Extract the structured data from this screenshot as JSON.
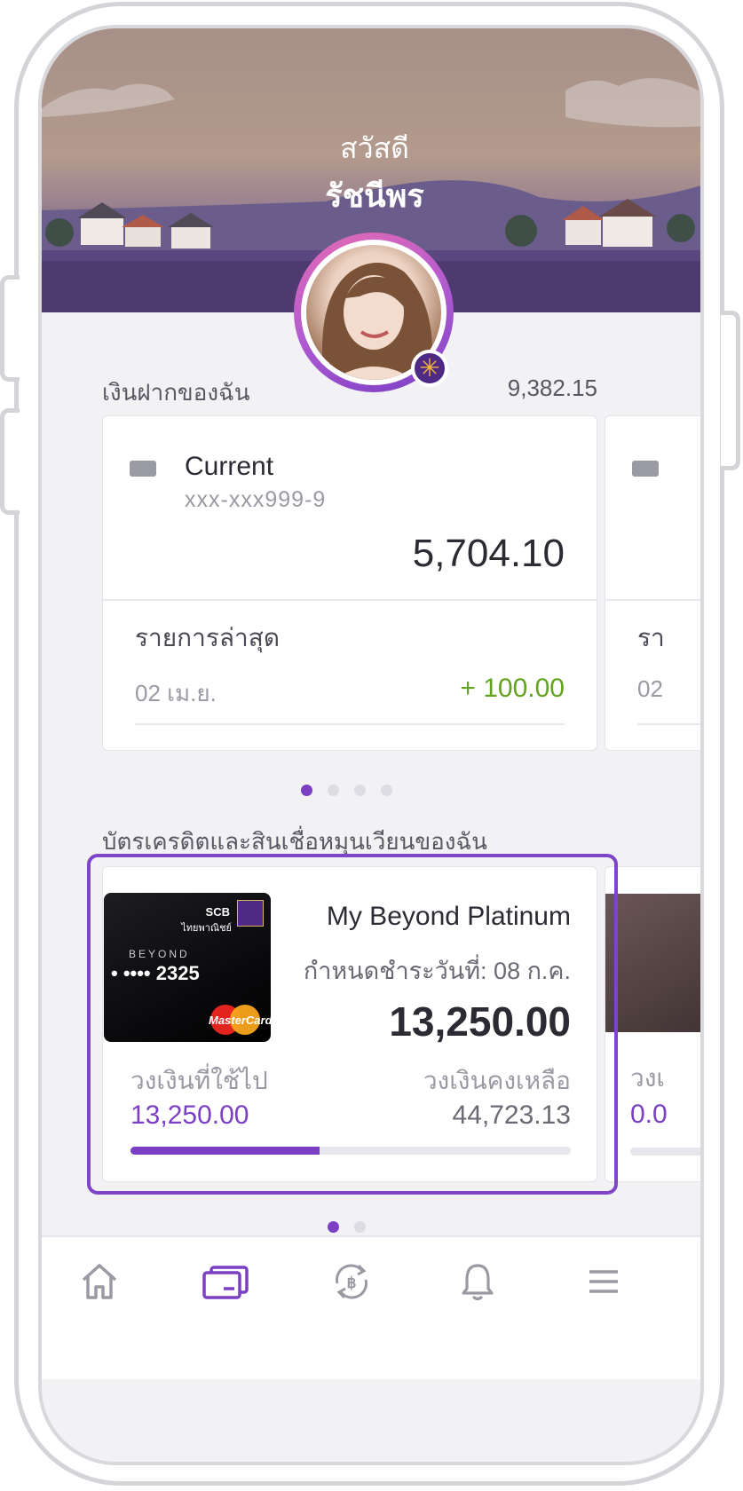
{
  "header": {
    "greeting": "สวัสดี",
    "name": "รัชนีพร"
  },
  "deposits": {
    "title": "เงินฝากของฉัน",
    "total": "9,382.15",
    "account": {
      "name": "Current",
      "number": "xxx-xxx999-9",
      "balance": "5,704.10",
      "recent_title": "รายการล่าสุด",
      "recent_date": "02 เม.ย.",
      "recent_amount": "+ 100.00"
    },
    "peek_card": {
      "recent_title_partial": "รา",
      "recent_date_partial": "02"
    },
    "pager": {
      "count": 4,
      "active": 0
    }
  },
  "credit": {
    "title": "บัตรเครดิตและสินเชื่อหมุนเวียนของฉัน",
    "card": {
      "bank_text": "SCB",
      "bank_text_th": "ไทยพาณิชย์",
      "brand_text": "BEYOND",
      "number_mask": "• •••• 2325",
      "network": "MasterCard",
      "name": "My Beyond Platinum",
      "due_label": "กำหนดชำระวันที่: 08 ก.ค.",
      "amount": "13,250.00",
      "used_label": "วงเงินที่ใช้ไป",
      "used_value": "13,250.00",
      "remaining_label": "วงเงินคงเหลือ",
      "remaining_value": "44,723.13",
      "used_fraction": 0.43
    },
    "peek_card": {
      "label_partial": "วงเ",
      "value_partial": "0.0"
    },
    "pager": {
      "count": 2,
      "active": 0
    },
    "highlight_color": "#7e45c8"
  },
  "nav": {
    "items": [
      "home-icon",
      "cards-icon",
      "bitcoin-exchange-icon",
      "bell-icon",
      "menu-icon"
    ],
    "active": "cards-icon"
  },
  "colors": {
    "accent": "#7b3fc4",
    "positive": "#63a31f"
  }
}
